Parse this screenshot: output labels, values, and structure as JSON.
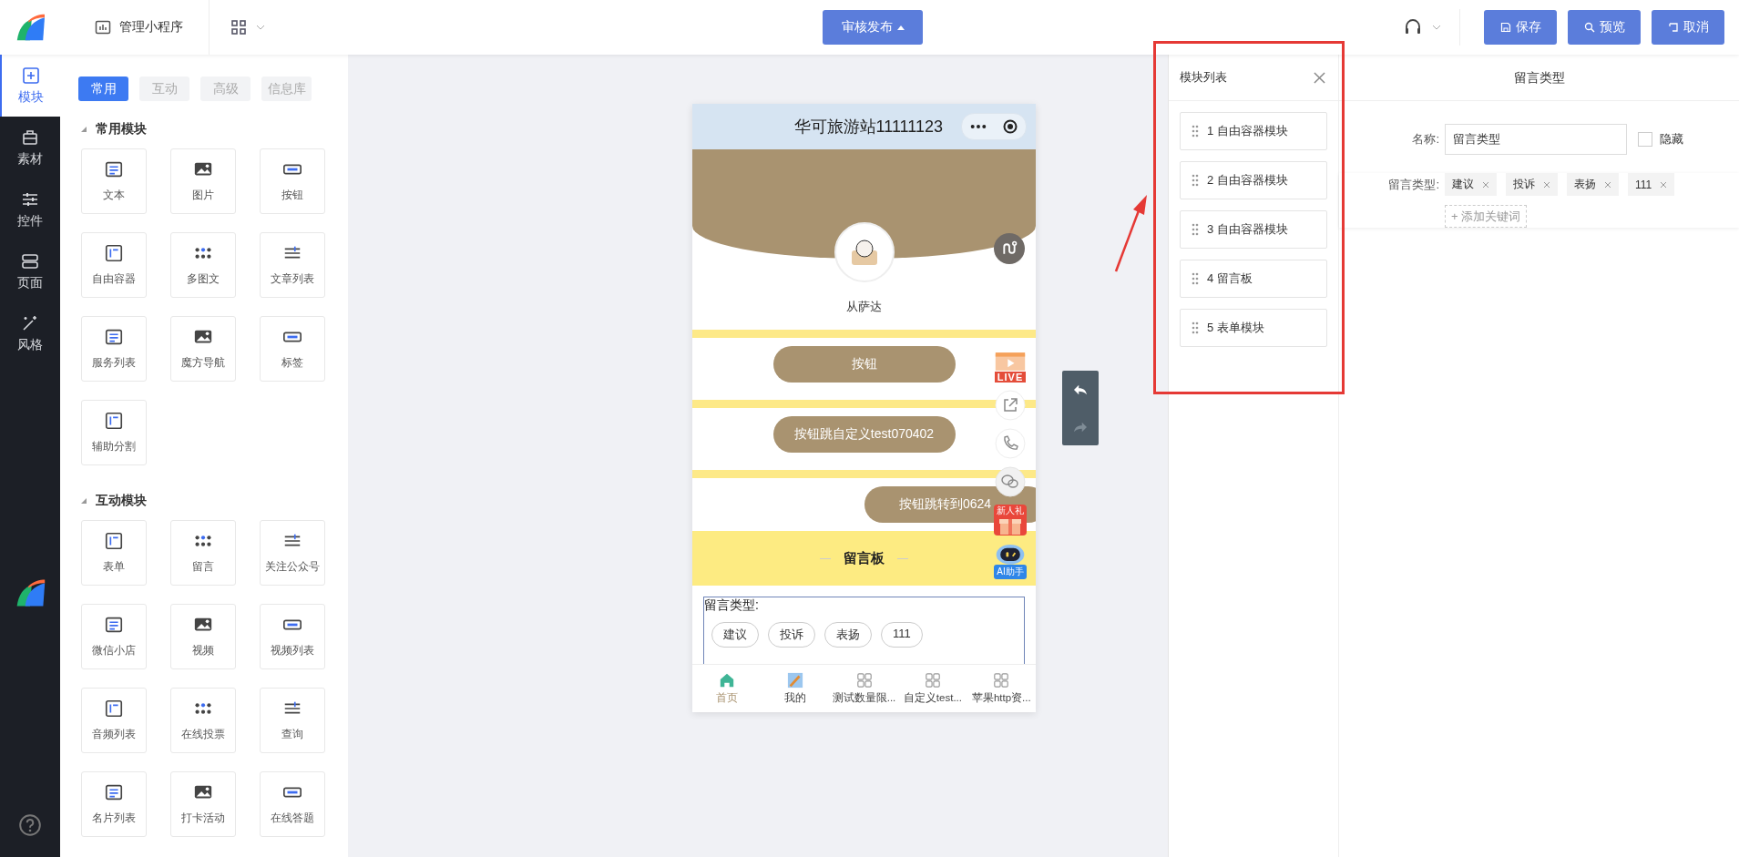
{
  "top_bar": {
    "manage_label": "管理小程序",
    "publish_button": "审核发布",
    "actions": [
      {
        "label": "保存",
        "kind": "save"
      },
      {
        "label": "预览",
        "kind": "preview"
      },
      {
        "label": "取消",
        "kind": "cancel"
      }
    ]
  },
  "side_nav": [
    {
      "label": "模块",
      "selected": true
    },
    {
      "label": "素材",
      "selected": false
    },
    {
      "label": "控件",
      "selected": false
    },
    {
      "label": "页面",
      "selected": false
    },
    {
      "label": "风格",
      "selected": false
    }
  ],
  "palette": {
    "tabs": [
      {
        "label": "常用",
        "selected": true
      },
      {
        "label": "互动",
        "selected": false
      },
      {
        "label": "高级",
        "selected": false
      },
      {
        "label": "信息库",
        "selected": false
      }
    ],
    "sections": [
      {
        "title": "常用模块",
        "items": [
          "文本",
          "图片",
          "按钮",
          "自由容器",
          "多图文",
          "文章列表",
          "服务列表",
          "魔方导航",
          "标签",
          "辅助分割"
        ]
      },
      {
        "title": "互动模块",
        "items": [
          "表单",
          "留言",
          "关注公众号",
          "微信小店",
          "视频",
          "视频列表",
          "音频列表",
          "在线投票",
          "查询",
          "名片列表",
          "打卡活动",
          "在线答题"
        ]
      }
    ]
  },
  "phone": {
    "title": "华可旅游站11111123",
    "profile_name": "从萨达",
    "buttons": [
      {
        "label": "按钮",
        "kind": "centered"
      },
      {
        "label": "按钮跳自定义test070402",
        "kind": "centered"
      },
      {
        "label": "按钮跳转到0624",
        "kind": "edge"
      }
    ],
    "board_title": "留言板",
    "form_label": "留言类型:",
    "form_tags": [
      "建议",
      "投诉",
      "表扬",
      "111"
    ],
    "floating": {
      "live_badge": "LIVE",
      "gift_badge": "新人礼",
      "ai_badge": "AI助手"
    },
    "tabbar": [
      {
        "label": "首页",
        "selected": true
      },
      {
        "label": "我的",
        "selected": false
      },
      {
        "label": "测试数量限...",
        "selected": false
      },
      {
        "label": "自定义test...",
        "selected": false
      },
      {
        "label": "苹果http资...",
        "selected": false
      }
    ]
  },
  "module_list": {
    "title": "模块列表",
    "items": [
      "1 自由容器模块",
      "2 自由容器模块",
      "3 自由容器模块",
      "4 留言板",
      "5 表单模块"
    ]
  },
  "properties": {
    "title": "留言类型",
    "name_label": "名称:",
    "name_value": "留言类型",
    "hidden": {
      "label": "隐藏",
      "checked": false
    },
    "type_label": "留言类型:",
    "tags": [
      "建议",
      "投诉",
      "表扬",
      "111"
    ],
    "add_keyword": "+ 添加关键词"
  }
}
